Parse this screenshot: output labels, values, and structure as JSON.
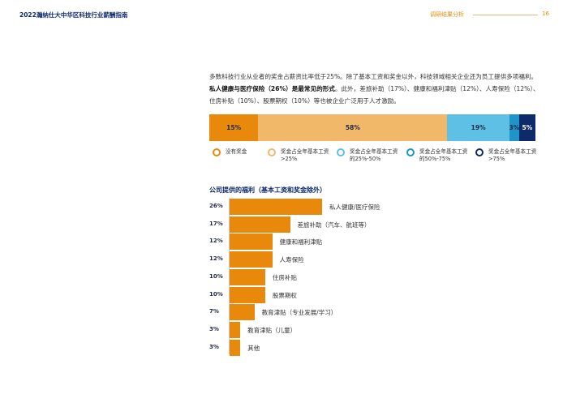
{
  "header": {
    "doc_title": "2022瀚纳仕大中华区科技行业薪酬指南",
    "section": "调研结果分析",
    "page_number": "16"
  },
  "intro": {
    "part1": "多数科技行业从业者的奖金占薪资比率低于25%。除了基本工资和奖金以外，科技领域相关企业还为员工提供多项福利。",
    "bold": "私人健康与医疗保险（26%）是最常见的形式",
    "part2": "。此外，差旅补助（17%）、健康和福利津贴（12%）、人寿保险（12%）、住房补贴（10%）、股票期权（10%）等也被企业广泛用于人才激励。"
  },
  "bonus_distribution": {
    "segments": [
      {
        "label": "15%",
        "value": 15,
        "color": "#e8890c"
      },
      {
        "label": "58%",
        "value": 58,
        "color": "#f2b86a"
      },
      {
        "label": "19%",
        "value": 19,
        "color": "#5fc0e6"
      },
      {
        "label": "3%",
        "value": 3,
        "color": "#1f94c8"
      },
      {
        "label": "5%",
        "value": 5,
        "color": "#0d2a6b"
      }
    ],
    "legend": [
      {
        "text": "没有奖金",
        "color": "#e8890c"
      },
      {
        "text": "奖金占全年基本工资>25%",
        "color": "#f2b86a"
      },
      {
        "text": "奖金占全年基本工资的25%-50%",
        "color": "#5fc0e6"
      },
      {
        "text": "奖金占全年基本工资的50%-75%",
        "color": "#1f94c8"
      },
      {
        "text": "奖金占全年基本工资>75%",
        "color": "#0d2a6b"
      }
    ]
  },
  "chart_data": {
    "type": "bar",
    "title": "公司提供的福利（基本工资和奖金除外）",
    "categories": [
      "私人健康/医疗保险",
      "差旅补助（汽车、航班等）",
      "健康和福利津贴",
      "人寿保险",
      "住房补贴",
      "股票期权",
      "教育津贴（专业发展/学习）",
      "教育津贴（儿童）",
      "其他"
    ],
    "values": [
      26,
      17,
      12,
      12,
      10,
      10,
      7,
      3,
      3
    ],
    "value_labels": [
      "26%",
      "17%",
      "12%",
      "12%",
      "10%",
      "10%",
      "7%",
      "3%",
      "3%"
    ],
    "color": "#e8890c",
    "orientation": "horizontal"
  }
}
